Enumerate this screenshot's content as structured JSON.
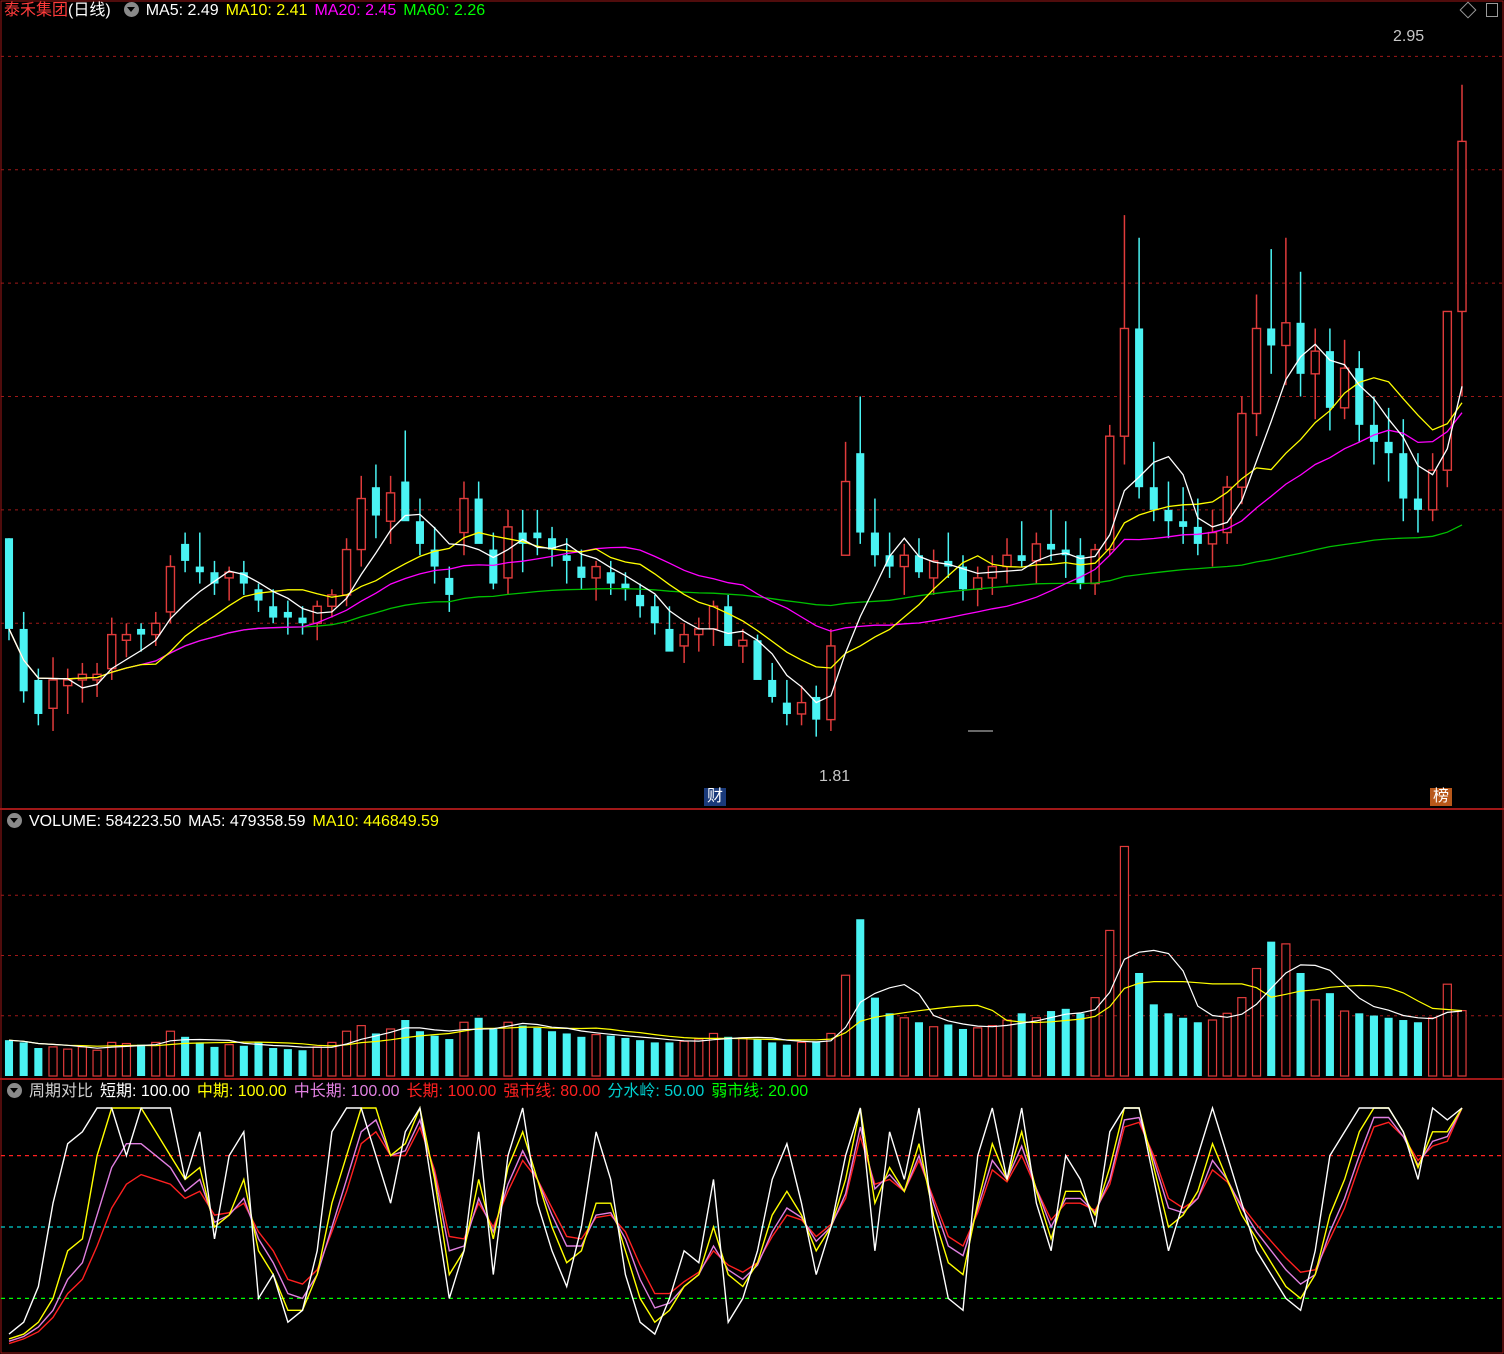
{
  "header": {
    "stock_name": "泰禾集团",
    "period": "(日线)",
    "ma5": "MA5: 2.49",
    "ma10": "MA10: 2.41",
    "ma20": "MA20: 2.45",
    "ma60": "MA60: 2.26"
  },
  "annotations": {
    "high_label": "2.95",
    "low_label": "1.81",
    "finance_tag": "财",
    "rank_tag": "榜"
  },
  "volume_header": {
    "volume": "VOLUME: 584223.50",
    "ma5": "MA5: 479358.59",
    "ma10": "MA10: 446849.59"
  },
  "indicator_header": {
    "name": "周期对比",
    "short": "短期: 100.00",
    "mid": "中期: 100.00",
    "midlong": "中长期: 100.00",
    "long": "长期: 100.00",
    "strong": "强市线: 80.00",
    "water": "分水岭: 50.00",
    "weak": "弱市线: 20.00"
  },
  "colors": {
    "up": "#e03b3b",
    "down": "#4af3f3",
    "ma5": "#ffffff",
    "ma10": "#ffff00",
    "ma20": "#ff00ff",
    "ma60": "#00c000",
    "grid": "#a01818",
    "short": "#ffffff",
    "mid": "#ffff00",
    "midlong": "#e080e0",
    "long": "#ff2020",
    "strong_line": "#ff2020",
    "water_line": "#00d0d0",
    "weak_line": "#00ff00"
  },
  "chart_data": [
    {
      "type": "candlestick",
      "title": "泰禾集团(日线)",
      "ylim": [
        1.72,
        3.05
      ],
      "annotations": [
        {
          "label": "2.95",
          "x": 121,
          "value": 2.95
        },
        {
          "label": "1.81",
          "x": 65,
          "value": 1.81
        }
      ],
      "candles": [
        [
          2.15,
          2.15,
          1.97,
          1.99
        ],
        [
          1.99,
          2.02,
          1.86,
          1.88
        ],
        [
          1.9,
          1.92,
          1.82,
          1.84
        ],
        [
          1.85,
          1.94,
          1.81,
          1.9
        ],
        [
          1.89,
          1.92,
          1.84,
          1.9
        ],
        [
          1.9,
          1.93,
          1.86,
          1.91
        ],
        [
          1.9,
          1.93,
          1.87,
          1.91
        ],
        [
          1.92,
          2.01,
          1.9,
          1.98
        ],
        [
          1.97,
          2.0,
          1.94,
          1.98
        ],
        [
          1.99,
          2.0,
          1.95,
          1.98
        ],
        [
          1.98,
          2.02,
          1.96,
          2.0
        ],
        [
          2.02,
          2.12,
          2.0,
          2.1
        ],
        [
          2.14,
          2.16,
          2.09,
          2.11
        ],
        [
          2.1,
          2.16,
          2.07,
          2.09
        ],
        [
          2.09,
          2.11,
          2.05,
          2.07
        ],
        [
          2.08,
          2.1,
          2.04,
          2.09
        ],
        [
          2.09,
          2.11,
          2.05,
          2.07
        ],
        [
          2.06,
          2.07,
          2.02,
          2.04
        ],
        [
          2.03,
          2.06,
          2.0,
          2.01
        ],
        [
          2.02,
          2.04,
          1.98,
          2.01
        ],
        [
          2.01,
          2.03,
          1.98,
          2.0
        ],
        [
          2.0,
          2.04,
          1.97,
          2.03
        ],
        [
          2.03,
          2.06,
          2.01,
          2.05
        ],
        [
          2.05,
          2.15,
          2.03,
          2.13
        ],
        [
          2.13,
          2.26,
          2.1,
          2.22
        ],
        [
          2.24,
          2.28,
          2.15,
          2.19
        ],
        [
          2.18,
          2.26,
          2.14,
          2.23
        ],
        [
          2.25,
          2.34,
          2.19,
          2.18
        ],
        [
          2.18,
          2.22,
          2.12,
          2.14
        ],
        [
          2.13,
          2.17,
          2.07,
          2.1
        ],
        [
          2.08,
          2.1,
          2.02,
          2.05
        ],
        [
          2.16,
          2.25,
          2.12,
          2.22
        ],
        [
          2.22,
          2.25,
          2.15,
          2.14
        ],
        [
          2.13,
          2.16,
          2.06,
          2.07
        ],
        [
          2.08,
          2.2,
          2.05,
          2.17
        ],
        [
          2.16,
          2.2,
          2.09,
          2.14
        ],
        [
          2.16,
          2.2,
          2.12,
          2.15
        ],
        [
          2.15,
          2.17,
          2.1,
          2.13
        ],
        [
          2.12,
          2.15,
          2.07,
          2.11
        ],
        [
          2.1,
          2.13,
          2.06,
          2.08
        ],
        [
          2.08,
          2.11,
          2.04,
          2.1
        ],
        [
          2.09,
          2.11,
          2.05,
          2.07
        ],
        [
          2.07,
          2.09,
          2.04,
          2.06
        ],
        [
          2.05,
          2.07,
          2.01,
          2.03
        ],
        [
          2.03,
          2.05,
          1.98,
          2.0
        ],
        [
          1.99,
          2.03,
          1.96,
          1.95
        ],
        [
          1.96,
          2.0,
          1.93,
          1.98
        ],
        [
          1.98,
          2.01,
          1.95,
          1.99
        ],
        [
          1.99,
          2.04,
          1.96,
          2.03
        ],
        [
          2.03,
          2.05,
          1.97,
          1.96
        ],
        [
          1.96,
          1.99,
          1.93,
          1.97
        ],
        [
          1.97,
          1.98,
          1.91,
          1.9
        ],
        [
          1.9,
          1.93,
          1.86,
          1.87
        ],
        [
          1.86,
          1.9,
          1.82,
          1.84
        ],
        [
          1.84,
          1.89,
          1.82,
          1.86
        ],
        [
          1.87,
          1.89,
          1.8,
          1.83
        ],
        [
          1.83,
          1.99,
          1.81,
          1.96
        ],
        [
          2.12,
          2.32,
          2.15,
          2.25
        ],
        [
          2.3,
          2.4,
          2.14,
          2.16
        ],
        [
          2.16,
          2.22,
          2.1,
          2.12
        ],
        [
          2.12,
          2.16,
          2.08,
          2.1
        ],
        [
          2.1,
          2.14,
          2.05,
          2.12
        ],
        [
          2.12,
          2.15,
          2.08,
          2.09
        ],
        [
          2.08,
          2.13,
          2.05,
          2.11
        ],
        [
          2.11,
          2.16,
          2.08,
          2.1
        ],
        [
          2.1,
          2.12,
          2.04,
          2.06
        ],
        [
          2.06,
          2.1,
          2.03,
          2.08
        ],
        [
          2.08,
          2.12,
          2.05,
          2.1
        ],
        [
          2.1,
          2.15,
          2.07,
          2.12
        ],
        [
          2.12,
          2.18,
          2.1,
          2.11
        ],
        [
          2.11,
          2.16,
          2.07,
          2.14
        ],
        [
          2.14,
          2.2,
          2.11,
          2.13
        ],
        [
          2.13,
          2.18,
          2.08,
          2.12
        ],
        [
          2.12,
          2.15,
          2.06,
          2.07
        ],
        [
          2.07,
          2.14,
          2.05,
          2.13
        ],
        [
          2.13,
          2.35,
          2.12,
          2.33
        ],
        [
          2.33,
          2.72,
          2.28,
          2.52
        ],
        [
          2.52,
          2.68,
          2.22,
          2.24
        ],
        [
          2.24,
          2.32,
          2.18,
          2.2
        ],
        [
          2.2,
          2.25,
          2.15,
          2.18
        ],
        [
          2.18,
          2.24,
          2.14,
          2.17
        ],
        [
          2.17,
          2.22,
          2.12,
          2.14
        ],
        [
          2.14,
          2.2,
          2.1,
          2.16
        ],
        [
          2.16,
          2.26,
          2.14,
          2.24
        ],
        [
          2.24,
          2.4,
          2.21,
          2.37
        ],
        [
          2.37,
          2.58,
          2.33,
          2.52
        ],
        [
          2.52,
          2.66,
          2.44,
          2.49
        ],
        [
          2.49,
          2.68,
          2.42,
          2.53
        ],
        [
          2.53,
          2.62,
          2.4,
          2.44
        ],
        [
          2.44,
          2.52,
          2.36,
          2.48
        ],
        [
          2.48,
          2.52,
          2.34,
          2.38
        ],
        [
          2.38,
          2.5,
          2.36,
          2.45
        ],
        [
          2.45,
          2.48,
          2.32,
          2.35
        ],
        [
          2.35,
          2.4,
          2.28,
          2.32
        ],
        [
          2.32,
          2.38,
          2.25,
          2.3
        ],
        [
          2.3,
          2.36,
          2.18,
          2.22
        ],
        [
          2.22,
          2.3,
          2.16,
          2.2
        ],
        [
          2.2,
          2.3,
          2.18,
          2.27
        ],
        [
          2.27,
          2.45,
          2.24,
          2.55
        ],
        [
          2.55,
          2.95,
          2.4,
          2.85
        ]
      ]
    },
    {
      "type": "bar",
      "title": "VOLUME",
      "series": [
        {
          "name": "VOLUME",
          "values": [
            320,
            300,
            250,
            260,
            240,
            260,
            230,
            300,
            290,
            280,
            300,
            400,
            350,
            300,
            260,
            280,
            270,
            300,
            250,
            240,
            230,
            260,
            300,
            400,
            450,
            380,
            420,
            500,
            400,
            360,
            330,
            480,
            520,
            420,
            480,
            450,
            430,
            400,
            380,
            350,
            370,
            360,
            340,
            320,
            300,
            300,
            310,
            330,
            380,
            350,
            340,
            330,
            300,
            280,
            300,
            310,
            380,
            900,
            1400,
            700,
            560,
            520,
            480,
            440,
            460,
            420,
            430,
            450,
            500,
            560,
            520,
            580,
            600,
            560,
            700,
            1300,
            2050,
            920,
            640,
            560,
            520,
            480,
            500,
            560,
            700,
            960,
            1200,
            1180,
            920,
            680,
            740,
            580,
            560,
            540,
            520,
            500,
            480,
            520,
            820,
            584
          ]
        }
      ]
    },
    {
      "type": "line",
      "title": "周期对比",
      "ylim": [
        0,
        100
      ],
      "reference_lines": [
        {
          "name": "强市线",
          "value": 80
        },
        {
          "name": "分水岭",
          "value": 50
        },
        {
          "name": "弱市线",
          "value": 20
        }
      ],
      "series": [
        {
          "name": "短期",
          "values": [
            5,
            10,
            25,
            60,
            85,
            90,
            100,
            100,
            80,
            100,
            100,
            100,
            70,
            90,
            45,
            80,
            90,
            20,
            30,
            10,
            15,
            40,
            90,
            100,
            100,
            80,
            60,
            90,
            100,
            60,
            20,
            40,
            90,
            30,
            80,
            100,
            60,
            40,
            25,
            50,
            90,
            70,
            30,
            10,
            5,
            20,
            40,
            35,
            70,
            10,
            20,
            40,
            70,
            85,
            60,
            30,
            50,
            80,
            100,
            40,
            90,
            70,
            100,
            50,
            20,
            15,
            80,
            100,
            70,
            100,
            60,
            40,
            80,
            70,
            50,
            90,
            100,
            100,
            70,
            40,
            60,
            80,
            100,
            80,
            60,
            40,
            30,
            20,
            15,
            40,
            80,
            90,
            100,
            100,
            100,
            90,
            70,
            100,
            95,
            100
          ]
        },
        {
          "name": "中期",
          "values": [
            3,
            5,
            10,
            20,
            40,
            45,
            80,
            100,
            100,
            100,
            90,
            80,
            70,
            75,
            50,
            55,
            70,
            40,
            30,
            15,
            15,
            30,
            60,
            80,
            100,
            100,
            80,
            85,
            100,
            70,
            30,
            40,
            70,
            45,
            75,
            90,
            70,
            50,
            35,
            40,
            60,
            60,
            40,
            20,
            10,
            15,
            25,
            30,
            50,
            30,
            25,
            35,
            55,
            65,
            55,
            40,
            50,
            70,
            100,
            60,
            75,
            65,
            85,
            55,
            35,
            30,
            60,
            85,
            70,
            90,
            65,
            45,
            65,
            65,
            55,
            75,
            100,
            100,
            75,
            50,
            55,
            65,
            85,
            70,
            55,
            45,
            35,
            25,
            20,
            30,
            55,
            70,
            90,
            100,
            100,
            90,
            75,
            90,
            90,
            100
          ]
        },
        {
          "name": "中长期",
          "values": [
            2,
            4,
            8,
            15,
            28,
            35,
            55,
            75,
            85,
            85,
            80,
            75,
            65,
            70,
            52,
            55,
            62,
            45,
            35,
            22,
            20,
            30,
            50,
            70,
            90,
            95,
            80,
            82,
            95,
            72,
            40,
            42,
            62,
            48,
            68,
            82,
            70,
            55,
            42,
            42,
            55,
            56,
            45,
            28,
            16,
            18,
            25,
            30,
            42,
            32,
            28,
            34,
            48,
            58,
            54,
            44,
            50,
            64,
            92,
            66,
            72,
            65,
            80,
            60,
            42,
            38,
            58,
            78,
            70,
            84,
            66,
            50,
            62,
            62,
            56,
            70,
            95,
            96,
            78,
            58,
            56,
            62,
            78,
            70,
            58,
            48,
            40,
            32,
            26,
            30,
            48,
            62,
            80,
            96,
            96,
            88,
            76,
            86,
            88,
            100
          ]
        },
        {
          "name": "长期",
          "values": [
            1,
            3,
            6,
            12,
            22,
            28,
            42,
            58,
            68,
            72,
            70,
            68,
            62,
            65,
            55,
            56,
            60,
            48,
            40,
            28,
            26,
            32,
            48,
            65,
            85,
            90,
            80,
            80,
            92,
            74,
            46,
            45,
            60,
            50,
            65,
            78,
            70,
            58,
            46,
            45,
            54,
            55,
            48,
            34,
            22,
            22,
            27,
            31,
            40,
            34,
            31,
            35,
            46,
            55,
            53,
            46,
            51,
            62,
            88,
            68,
            70,
            65,
            78,
            62,
            46,
            42,
            56,
            74,
            69,
            80,
            66,
            53,
            60,
            60,
            57,
            68,
            92,
            94,
            80,
            62,
            58,
            62,
            74,
            69,
            59,
            51,
            44,
            37,
            31,
            32,
            45,
            58,
            76,
            92,
            94,
            88,
            78,
            84,
            86,
            100
          ]
        }
      ]
    }
  ]
}
